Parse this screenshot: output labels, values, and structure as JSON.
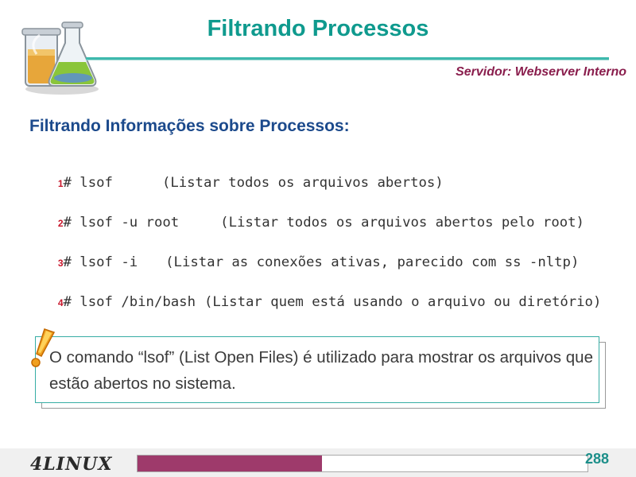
{
  "header": {
    "title": "Filtrando Processos",
    "server_label": "Servidor: Webserver Interno",
    "logo_icon": "lab-flasks-icon"
  },
  "section": {
    "heading": "Filtrando Informações sobre Processos:"
  },
  "commands": [
    {
      "num": "1",
      "cmd": "# lsof",
      "desc": "(Listar todos os arquivos abertos)"
    },
    {
      "num": "2",
      "cmd": "# lsof -u root",
      "desc": "(Listar todos os arquivos abertos pelo root)"
    },
    {
      "num": "3",
      "cmd": "# lsof -i",
      "desc": "(Listar as conexões ativas, parecido com ss -nltp)"
    },
    {
      "num": "4",
      "cmd": "# lsof /bin/bash",
      "desc": "(Listar quem está usando o arquivo ou diretório)"
    }
  ],
  "note": {
    "icon": "exclamation-icon",
    "text": "O comando “lsof” (List Open Files) é utilizado para mostrar os arquivos que estão abertos no sistema."
  },
  "footer": {
    "brand": "4LINUX",
    "page": "288",
    "progress_fraction": 0.41,
    "accent": "#9e3a6b"
  }
}
